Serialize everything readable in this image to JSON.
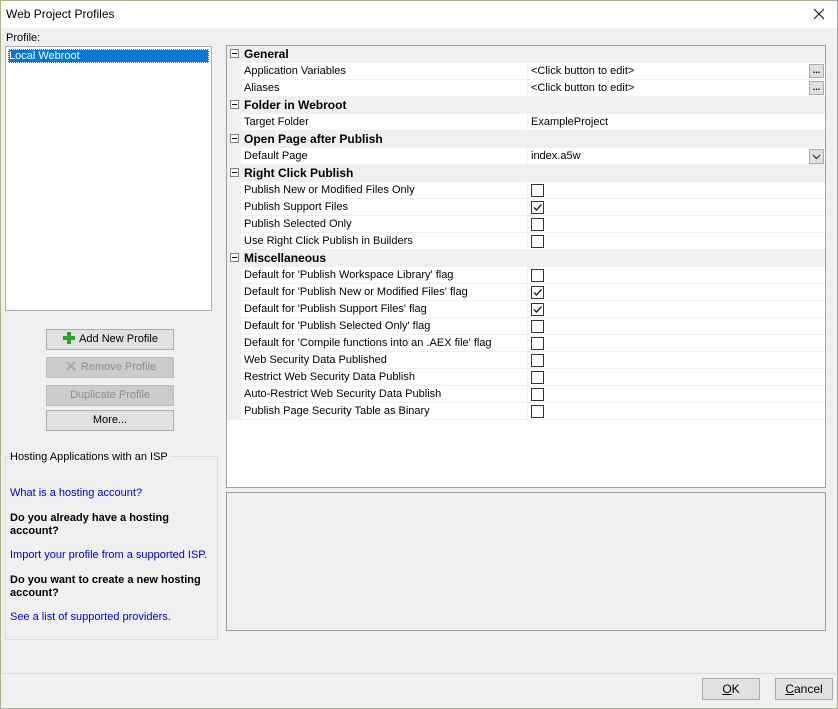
{
  "window": {
    "title": "Web Project Profiles"
  },
  "profile": {
    "label": "Profile:",
    "items": [
      "Local Webroot"
    ]
  },
  "buttons": {
    "add": "Add New Profile",
    "remove": "Remove Profile",
    "duplicate": "Duplicate Profile",
    "more": "More..."
  },
  "isp": {
    "heading": "Hosting Applications with an ISP",
    "link_what": "What is a hosting account?",
    "q_have": "Do you already have a hosting account?",
    "link_import": "Import your profile from a supported ISP.",
    "q_create": "Do you want to create a new hosting account?",
    "link_list": "See a list of supported providers."
  },
  "grid": {
    "general": "General",
    "app_vars": {
      "name": "Application Variables",
      "value": "<Click button to edit>"
    },
    "aliases": {
      "name": "Aliases",
      "value": "<Click button to edit>"
    },
    "folder": "Folder in Webroot",
    "target_folder": {
      "name": "Target Folder",
      "value": "ExampleProject"
    },
    "open_page": "Open Page after Publish",
    "default_page": {
      "name": "Default Page",
      "value": "index.a5w"
    },
    "right_click": "Right Click Publish",
    "rc1": {
      "name": "Publish New or Modified Files Only",
      "checked": false
    },
    "rc2": {
      "name": "Publish Support Files",
      "checked": true
    },
    "rc3": {
      "name": "Publish Selected Only",
      "checked": false
    },
    "rc4": {
      "name": "Use Right Click Publish in Builders",
      "checked": false
    },
    "misc": "Miscellaneous",
    "m1": {
      "name": "Default for 'Publish Workspace Library' flag",
      "checked": false
    },
    "m2": {
      "name": "Default for 'Publish New or Modified Files' flag",
      "checked": true
    },
    "m3": {
      "name": "Default for 'Publish Support Files' flag",
      "checked": true
    },
    "m4": {
      "name": "Default for 'Publish Selected Only' flag",
      "checked": false
    },
    "m5": {
      "name": "Default for 'Compile functions into an .AEX file' flag",
      "checked": false
    },
    "m6": {
      "name": "Web Security Data Published",
      "checked": false
    },
    "m7": {
      "name": "Restrict Web Security Data Publish",
      "checked": false
    },
    "m8": {
      "name": "Auto-Restrict Web Security Data Publish",
      "checked": false
    },
    "m9": {
      "name": "Publish Page Security Table as Binary",
      "checked": false
    },
    "ellipsis": "...",
    "dropdown_glyph": "v"
  },
  "dialog": {
    "ok_u": "O",
    "ok_rest": "K",
    "cancel_u": "C",
    "cancel_rest": "ancel"
  },
  "icons": {
    "close": "close-icon",
    "add": "plus-icon",
    "remove": "x-icon",
    "check": "checkmark-icon",
    "collapse": "minus-icon",
    "dropdown": "chevron-down-icon"
  },
  "colors": {
    "selection": "#0078d7",
    "link": "#0000cc",
    "add_icon": "#2aa52a"
  }
}
